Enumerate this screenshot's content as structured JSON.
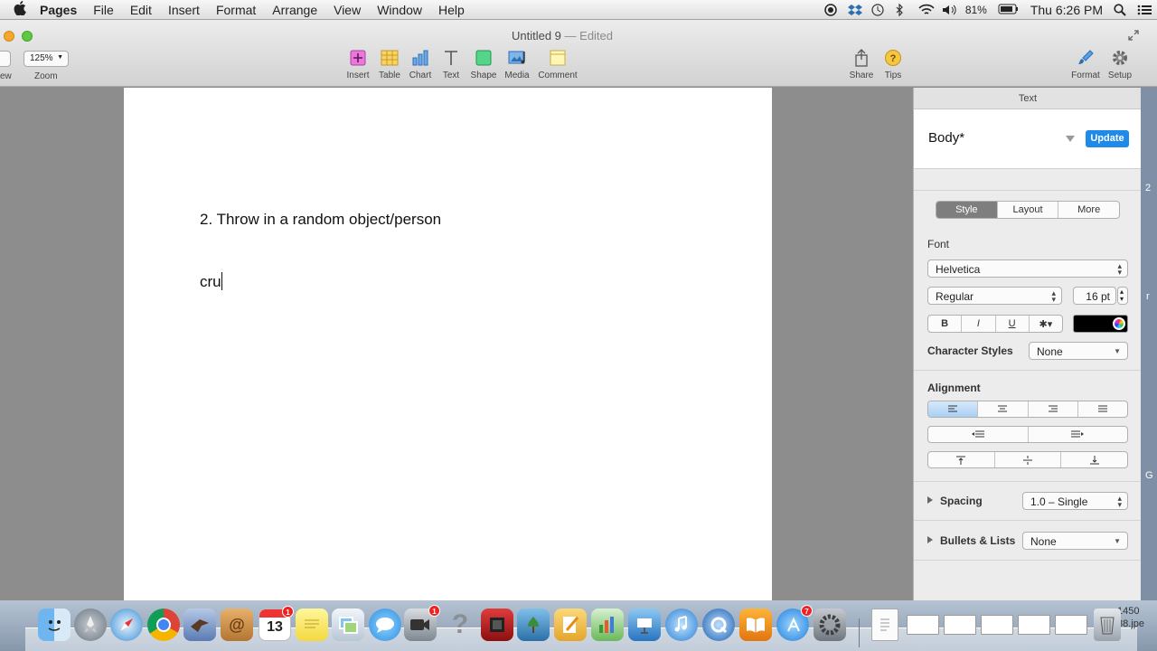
{
  "menubar": {
    "apple": "",
    "app": "Pages",
    "items": [
      "File",
      "Edit",
      "Insert",
      "Format",
      "Arrange",
      "View",
      "Window",
      "Help"
    ],
    "battery": "81%",
    "clock": "Thu 6:26 PM"
  },
  "window": {
    "title": "Untitled 9",
    "title_state": "— Edited",
    "toolbar": {
      "view_label": "ew",
      "zoom_value": "125%",
      "zoom_label": "Zoom",
      "insert_label": "Insert",
      "table_label": "Table",
      "chart_label": "Chart",
      "text_label": "Text",
      "shape_label": "Shape",
      "media_label": "Media",
      "comment_label": "Comment",
      "share_label": "Share",
      "tips_label": "Tips",
      "format_label": "Format",
      "setup_label": "Setup"
    }
  },
  "document": {
    "line1": "2. Throw in a random object/person",
    "line2": "cru"
  },
  "sidebar": {
    "header": "Text",
    "paragraph_style": "Body*",
    "update_label": "Update",
    "tabs": [
      "Style",
      "Layout",
      "More"
    ],
    "font_label": "Font",
    "font_family": "Helvetica",
    "font_typeface": "Regular",
    "font_size": "16 pt",
    "bold": "B",
    "italic": "I",
    "underline": "U",
    "gear": "✱▾",
    "text_color": "#000000",
    "character_styles_label": "Character Styles",
    "character_styles_value": "None",
    "alignment_label": "Alignment",
    "spacing_label": "Spacing",
    "spacing_value": "1.0 – Single",
    "bullets_label": "Bullets & Lists",
    "bullets_value": "None"
  },
  "desktop_fragments": {
    "f1": "2",
    "f2": "r",
    "f3": "G",
    "f4": "1450",
    "f5": "88.jpe"
  },
  "dock": {
    "calendar_day": "13",
    "calendar_badge": "1",
    "facetime_badge": "1",
    "appstore_badge": "7"
  }
}
